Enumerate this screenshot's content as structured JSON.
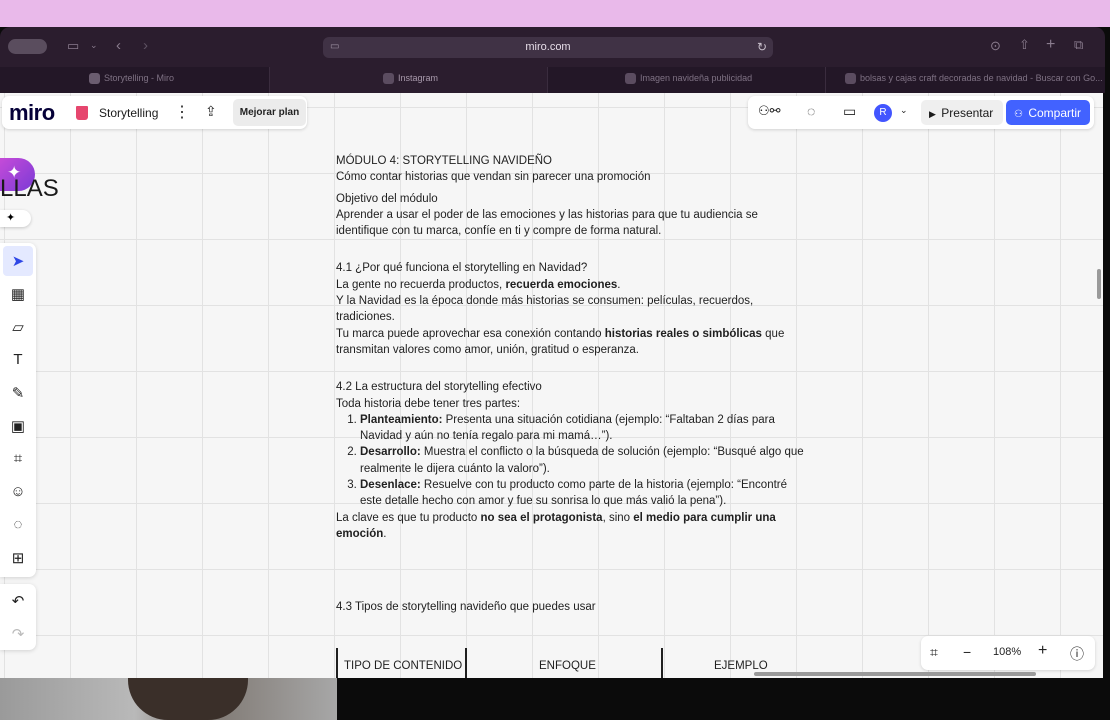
{
  "browser": {
    "url": "miro.com",
    "tabs": [
      {
        "title": "Storytelling - Miro",
        "active": true
      },
      {
        "title": "Instagram",
        "active": false
      },
      {
        "title": "Imagen navideña publicidad",
        "active": false
      },
      {
        "title": "bolsas y cajas craft decoradas de navidad - Buscar con Go...",
        "active": false
      }
    ]
  },
  "miro": {
    "logo": "miro",
    "board_name": "Storytelling",
    "upgrade_label": "Mejorar plan",
    "avatar_initial": "R",
    "present_label": "Presentar",
    "share_label": "Compartir",
    "frame_title_partial": "LLAS",
    "zoom": "108%"
  },
  "doc": {
    "title": "MÓDULO 4: STORYTELLING NAVIDEÑO",
    "subtitle": "Cómo contar historias que vendan sin parecer una promoción",
    "objective_heading": "Objetivo del módulo",
    "objective_line1": "Aprender a usar el poder de las emociones y las historias para que tu audiencia se",
    "objective_line2": "identifique con tu marca, confíe en ti y compre de forma natural.",
    "s41_heading": "4.1 ¿Por qué funciona el storytelling en Navidad?",
    "s41_l1a": "La gente no recuerda productos, ",
    "s41_l1b": "recuerda emociones",
    "s41_l1c": ".",
    "s41_l2": "Y la Navidad es la época donde más historias se consumen: películas, recuerdos,",
    "s41_l3": "tradiciones.",
    "s41_l4a": " Tu marca puede aprovechar esa conexión contando ",
    "s41_l4b": "historias reales o simbólicas",
    "s41_l4c": " que",
    "s41_l5": "transmitan valores como amor, unión, gratitud o esperanza.",
    "s42_heading": "4.2 La estructura del storytelling efectivo",
    "s42_intro": "Toda historia debe tener tres partes:",
    "steps": [
      {
        "bold": "Planteamiento:",
        "line1": " Presenta una situación cotidiana (ejemplo: “Faltaban 2 días para",
        "line2": "Navidad y aún no tenía regalo para mi mamá…”)."
      },
      {
        "bold": "Desarrollo:",
        "line1": " Muestra el conflicto o la búsqueda de solución (ejemplo: “Busqué algo que",
        "line2": "realmente le dijera cuánto la valoro”)."
      },
      {
        "bold": "Desenlace:",
        "line1": " Resuelve con tu producto como parte de la historia (ejemplo: “Encontré",
        "line2": "este detalle hecho con amor y fue su sonrisa lo que más valió la pena”)."
      }
    ],
    "s42_close_a": " La clave es que tu producto ",
    "s42_close_b": "no sea el protagonista",
    "s42_close_c": ", sino ",
    "s42_close_d": "el medio para cumplir una",
    "s42_close_e": "emoción",
    "s42_close_f": ".",
    "s43_heading": "4.3 Tipos de storytelling navideño que puedes usar",
    "table_headers": [
      "TIPO DE CONTENIDO",
      "ENFOQUE",
      "EJEMPLO"
    ]
  },
  "icons": [
    "apple-icon",
    "sidebar-icon",
    "back-icon",
    "forward-icon",
    "reload-icon",
    "download-icon",
    "share-icon",
    "new-tab-icon",
    "tab-overview-icon",
    "select-icon",
    "frame-template-icon",
    "sticky-note-icon",
    "text-icon",
    "pen-icon",
    "shapes-icon",
    "crop-icon",
    "sticker-icon",
    "comment-icon",
    "add-icon",
    "undo-icon",
    "redo-icon",
    "fit-icon",
    "zoom-out-icon",
    "zoom-in-icon",
    "help-icon"
  ]
}
